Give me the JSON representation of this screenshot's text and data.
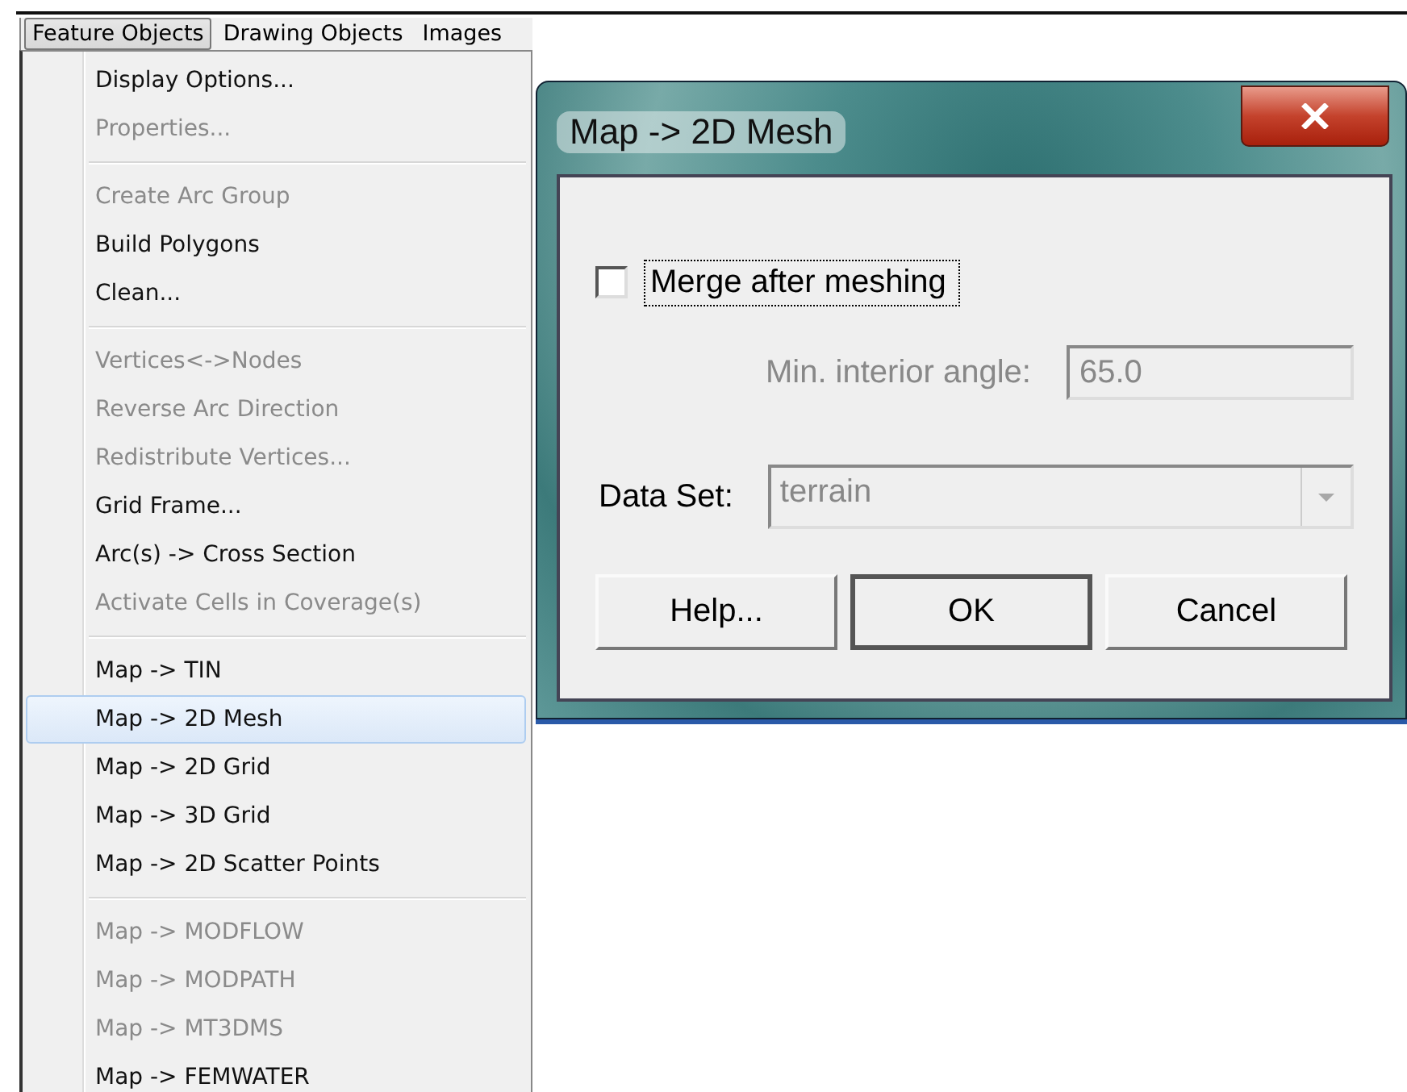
{
  "menubar": [
    {
      "label": "Feature Objects",
      "selected": true
    },
    {
      "label": "Drawing Objects",
      "selected": false
    },
    {
      "label": "Images",
      "selected": false
    }
  ],
  "menu": {
    "groups": [
      {
        "items": [
          {
            "label": "Display Options...",
            "disabled": false,
            "selected": false
          },
          {
            "label": "Properties...",
            "disabled": true,
            "selected": false
          }
        ]
      },
      {
        "items": [
          {
            "label": "Create Arc Group",
            "disabled": true,
            "selected": false
          },
          {
            "label": "Build Polygons",
            "disabled": false,
            "selected": false
          },
          {
            "label": "Clean...",
            "disabled": false,
            "selected": false
          }
        ]
      },
      {
        "items": [
          {
            "label": "Vertices<->Nodes",
            "disabled": true,
            "selected": false
          },
          {
            "label": "Reverse Arc Direction",
            "disabled": true,
            "selected": false
          },
          {
            "label": "Redistribute Vertices...",
            "disabled": true,
            "selected": false
          },
          {
            "label": "Grid Frame...",
            "disabled": false,
            "selected": false
          },
          {
            "label": "Arc(s) -> Cross Section",
            "disabled": false,
            "selected": false
          },
          {
            "label": "Activate Cells in Coverage(s)",
            "disabled": true,
            "selected": false
          }
        ]
      },
      {
        "items": [
          {
            "label": "Map -> TIN",
            "disabled": false,
            "selected": false
          },
          {
            "label": "Map -> 2D Mesh",
            "disabled": false,
            "selected": true
          },
          {
            "label": "Map -> 2D Grid",
            "disabled": false,
            "selected": false
          },
          {
            "label": "Map -> 3D Grid",
            "disabled": false,
            "selected": false
          },
          {
            "label": "Map -> 2D Scatter Points",
            "disabled": false,
            "selected": false
          }
        ]
      },
      {
        "items": [
          {
            "label": "Map -> MODFLOW",
            "disabled": true,
            "selected": false
          },
          {
            "label": "Map -> MODPATH",
            "disabled": true,
            "selected": false
          },
          {
            "label": "Map -> MT3DMS",
            "disabled": true,
            "selected": false
          },
          {
            "label": "Map -> FEMWATER",
            "disabled": false,
            "selected": false
          }
        ]
      }
    ]
  },
  "dialog": {
    "title": "Map -> 2D Mesh",
    "checkbox": {
      "label": "Merge after meshing",
      "checked": false,
      "focused": true
    },
    "angle": {
      "label": "Min. interior angle:",
      "value": "65.0",
      "disabled": true
    },
    "data_set": {
      "label": "Data Set:",
      "value": "terrain",
      "disabled": true
    },
    "buttons": [
      {
        "label": "Help...",
        "default": false
      },
      {
        "label": "OK",
        "default": true
      },
      {
        "label": "Cancel",
        "default": false
      }
    ]
  }
}
